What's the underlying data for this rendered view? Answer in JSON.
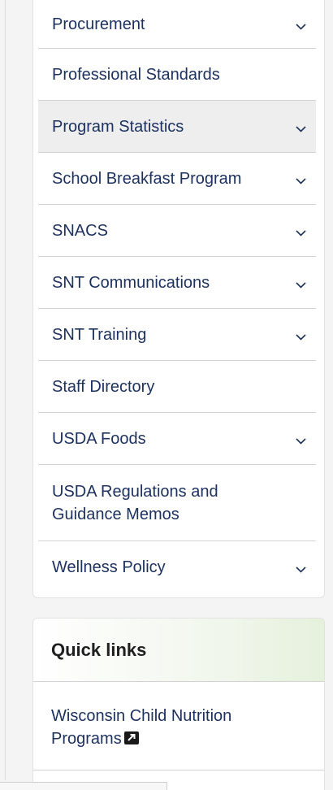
{
  "nav": {
    "items": [
      {
        "label": "Procurement",
        "expandable": true
      },
      {
        "label": "Professional Standards",
        "expandable": false
      },
      {
        "label": "Program Statistics",
        "expandable": true,
        "active": true
      },
      {
        "label": "School Breakfast Program",
        "expandable": true
      },
      {
        "label": "SNACS",
        "expandable": true
      },
      {
        "label": "SNT Communications",
        "expandable": true
      },
      {
        "label": "SNT Training",
        "expandable": true
      },
      {
        "label": "Staff Directory",
        "expandable": false
      },
      {
        "label": "USDA Foods",
        "expandable": true
      },
      {
        "label": "USDA Regulations and Guidance Memos",
        "expandable": false
      },
      {
        "label": "Wellness Policy",
        "expandable": true
      }
    ]
  },
  "quick_links": {
    "title": "Quick links",
    "items": [
      {
        "label": "Wisconsin Child Nutrition Programs",
        "external": true
      }
    ]
  },
  "colors": {
    "link": "#1e3260",
    "active_bg": "#eeeeee",
    "divider": "#d3d3d3",
    "header_green": "#e6f1dc"
  },
  "icons": {
    "expand": "chevron-down-icon",
    "external": "external-link-icon"
  }
}
